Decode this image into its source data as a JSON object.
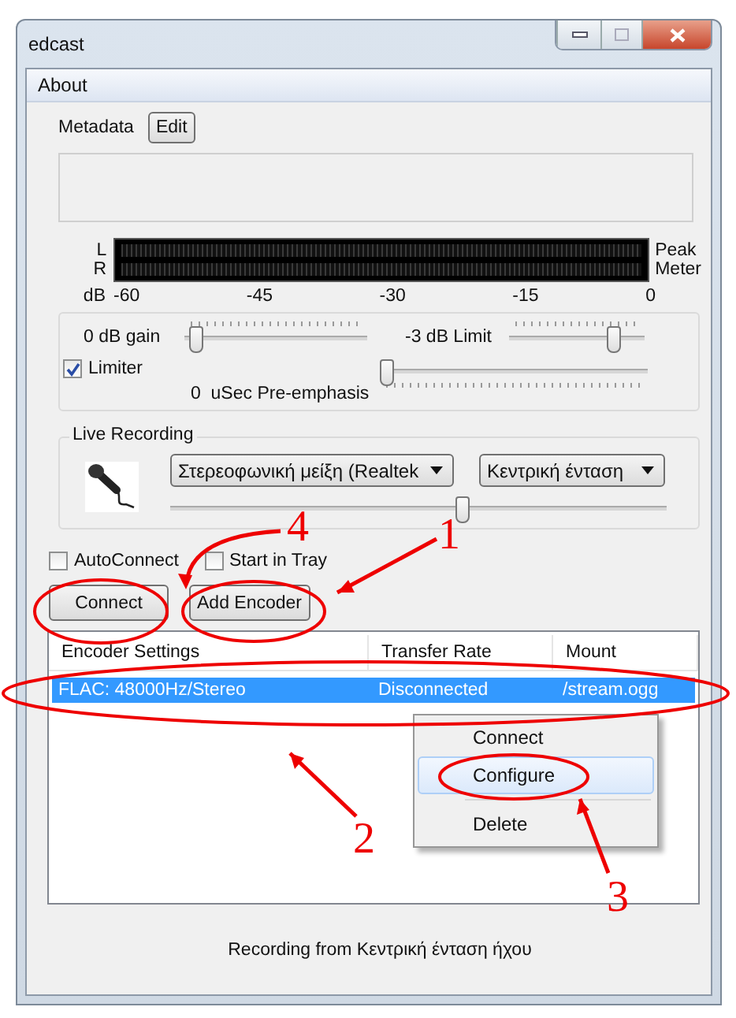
{
  "window": {
    "title": "edcast"
  },
  "menu": [
    "About"
  ],
  "metadata": {
    "label": "Metadata",
    "button": "Edit"
  },
  "meter": {
    "channels": [
      "L",
      "R"
    ],
    "legend": [
      "Peak",
      "Meter"
    ],
    "scale_unit": "dB",
    "scale": [
      "-60",
      "-45",
      "-30",
      "-15",
      "0"
    ]
  },
  "processing": {
    "gain": {
      "label": "0 dB gain",
      "level": 0.03
    },
    "limit": {
      "label": "-3 dB Limit",
      "level": 0.8
    },
    "limiter": {
      "label": "Limiter",
      "checked": true
    },
    "pre_emphasis": {
      "label": "0  uSec Pre-emphasis",
      "level": 0.0
    }
  },
  "live_recording": {
    "title": "Live Recording",
    "device": "Στερεοφωνική μείξη (Realtek",
    "line": "Κεντρική ένταση",
    "volume": {
      "level": 0.59
    }
  },
  "options": [
    {
      "label": "AutoConnect",
      "checked": false
    },
    {
      "label": "Start in Tray",
      "checked": false
    }
  ],
  "buttons": [
    "Connect",
    "Add Encoder"
  ],
  "encoders": {
    "columns": [
      "Encoder Settings",
      "Transfer Rate",
      "Mount"
    ],
    "rows": [
      {
        "cells": [
          "FLAC: 48000Hz/Stereo",
          "Disconnected",
          "/stream.ogg"
        ],
        "selected": true
      }
    ]
  },
  "context_menu": [
    {
      "kind": "command",
      "label": "Connect",
      "selected": false
    },
    {
      "kind": "command",
      "label": "Configure",
      "selected": true
    },
    {
      "kind": "separator"
    },
    {
      "kind": "command",
      "label": "Delete",
      "selected": false
    }
  ],
  "status": "Recording from Κεντρική ένταση ήχου",
  "annotations": [
    {
      "number": "4"
    },
    {
      "number": "1"
    },
    {
      "number": "2"
    },
    {
      "number": "3"
    }
  ]
}
